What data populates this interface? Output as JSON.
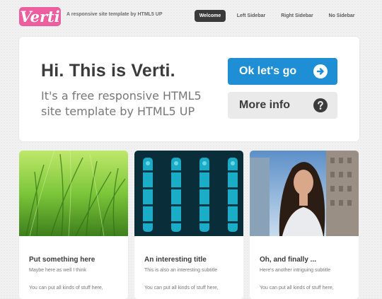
{
  "header": {
    "logo": "Verti",
    "tagline": "A responsive site template by HTML5 UP",
    "nav": [
      {
        "label": "Welcome",
        "active": true
      },
      {
        "label": "Left Sidebar",
        "active": false
      },
      {
        "label": "Right Sidebar",
        "active": false
      },
      {
        "label": "No Sidebar",
        "active": false
      }
    ]
  },
  "banner": {
    "title": "Hi. This is Verti.",
    "subtitle": "It's a free responsive HTML5 site template by HTML5 UP",
    "primary_button": "Ok let's go",
    "secondary_button": "More info",
    "primary_icon": "arrow-right-circle-icon",
    "secondary_icon": "question-circle-icon"
  },
  "cards": [
    {
      "image": "grass-photo",
      "title": "Put something here",
      "subtitle": "Maybe here as well I think",
      "body": "You can put all kinds of stuff here,"
    },
    {
      "image": "server-rack-photo",
      "title": "An interesting title",
      "subtitle": "This is also an interesting subtitle",
      "body": "You can put all kinds of stuff here,"
    },
    {
      "image": "woman-portrait-photo",
      "title": "Oh, and finally ...",
      "subtitle": "Here's another intriguing subtitle",
      "body": "You can put all kinds of stuff here,"
    }
  ],
  "colors": {
    "logo": "#ec5e9e",
    "primary": "#1e8fd5",
    "nav_active": "#3a3a3a"
  }
}
